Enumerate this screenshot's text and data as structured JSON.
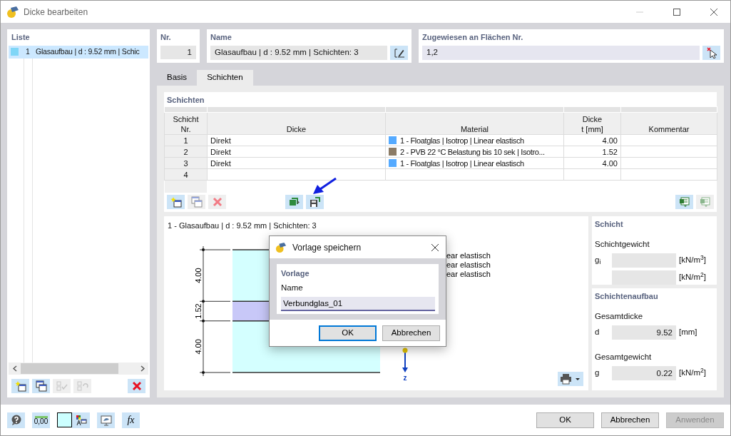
{
  "window": {
    "title": "Dicke bearbeiten"
  },
  "list": {
    "title": "Liste",
    "items": [
      {
        "nr": "1",
        "name": "Glasaufbau | d : 9.52 mm | Schic",
        "selected": true
      }
    ],
    "toolbar": [
      {
        "kind": "new",
        "disabled": false
      },
      {
        "kind": "copy",
        "disabled": false
      },
      {
        "kind": "check-all",
        "disabled": true
      },
      {
        "kind": "check-toggle",
        "disabled": true
      },
      {
        "kind": "delete",
        "disabled": false
      }
    ]
  },
  "nr": {
    "label": "Nr.",
    "value": "1"
  },
  "name": {
    "label": "Name",
    "value": "Glasaufbau | d : 9.52 mm | Schichten: 3"
  },
  "assigned": {
    "label": "Zugewiesen an Flächen Nr.",
    "value": "1,2"
  },
  "tabs": [
    {
      "label": "Basis",
      "selected": false
    },
    {
      "label": "Schichten",
      "selected": true
    }
  ],
  "layers_table": {
    "title": "Schichten",
    "columns": [
      "Schicht\nNr.",
      "Dicke",
      "Material",
      "Dicke\nt [mm]",
      "Kommentar"
    ],
    "rows": [
      {
        "nr": "1",
        "thickness_type": "Direkt",
        "material": "1 - Floatglas | Isotrop | Linear elastisch",
        "color": "#55aaff",
        "thickness": "4.00"
      },
      {
        "nr": "2",
        "thickness_type": "Direkt",
        "material": "2 - PVB 22 °C Belastung bis 10 sek | Isotro...",
        "color": "#8b7b66",
        "thickness": "1.52"
      },
      {
        "nr": "3",
        "thickness_type": "Direkt",
        "material": "1 - Floatglas | Isotrop | Linear elastisch",
        "color": "#55aaff",
        "thickness": "4.00"
      },
      {
        "nr": "4"
      }
    ],
    "toolbar": [
      {
        "kind": "new",
        "disabled": false
      },
      {
        "kind": "copy",
        "disabled": true
      },
      {
        "kind": "delete",
        "disabled": true
      },
      {
        "kind": "import",
        "disabled": false
      },
      {
        "kind": "save",
        "disabled": false
      }
    ],
    "toolbar_right": [
      {
        "kind": "export",
        "disabled": false
      },
      {
        "kind": "export",
        "disabled": true
      }
    ]
  },
  "preview": {
    "title": "1 - Glasaufbau | d : 9.52 mm | Schichten: 3",
    "layers": [
      {
        "dimension": "4.00",
        "color": "#d4ffff"
      },
      {
        "dimension": "1.52",
        "color": "#c8c8f8"
      },
      {
        "dimension": "4.00",
        "color": "#d4ffff"
      }
    ],
    "legend": [
      "ear elastisch",
      "ear elastisch",
      "ear elastisch"
    ],
    "axis_label": "z"
  },
  "layer_panel": {
    "title": "Schicht",
    "subtitle": "Schichtgewicht",
    "rows": [
      {
        "symbol": "g$_{i}$",
        "unit": "[kN/m$^{3}$]"
      },
      {
        "unit": "[kN/m$^{2}$]"
      }
    ]
  },
  "buildup_panel": {
    "title": "Schichtenaufbau",
    "groups": [
      {
        "label": "Gesamtdicke",
        "symbol": "d",
        "value": "9.52",
        "unit": "[mm]"
      },
      {
        "label": "Gesamtgewicht",
        "symbol": "g",
        "value": "0.22",
        "unit": "[kN/m$^{2}$]"
      }
    ]
  },
  "footer_tools": [
    {
      "kind": "help"
    },
    {
      "kind": "units",
      "text": "0,00"
    },
    {
      "kind": "swatch"
    },
    {
      "kind": "text-color"
    },
    {
      "kind": "view"
    },
    {
      "kind": "formula",
      "text": "fx"
    }
  ],
  "buttons": [
    {
      "label": "OK",
      "disabled": false
    },
    {
      "label": "Abbrechen",
      "disabled": false
    },
    {
      "label": "Anwenden",
      "disabled": true
    }
  ],
  "dialog": {
    "title": "Vorlage speichern",
    "group": "Vorlage",
    "field_label": "Name",
    "value": "Verbundglas_01",
    "buttons": [
      {
        "label": "OK",
        "focused": true
      },
      {
        "label": "Abbrechen",
        "focused": false
      }
    ]
  }
}
